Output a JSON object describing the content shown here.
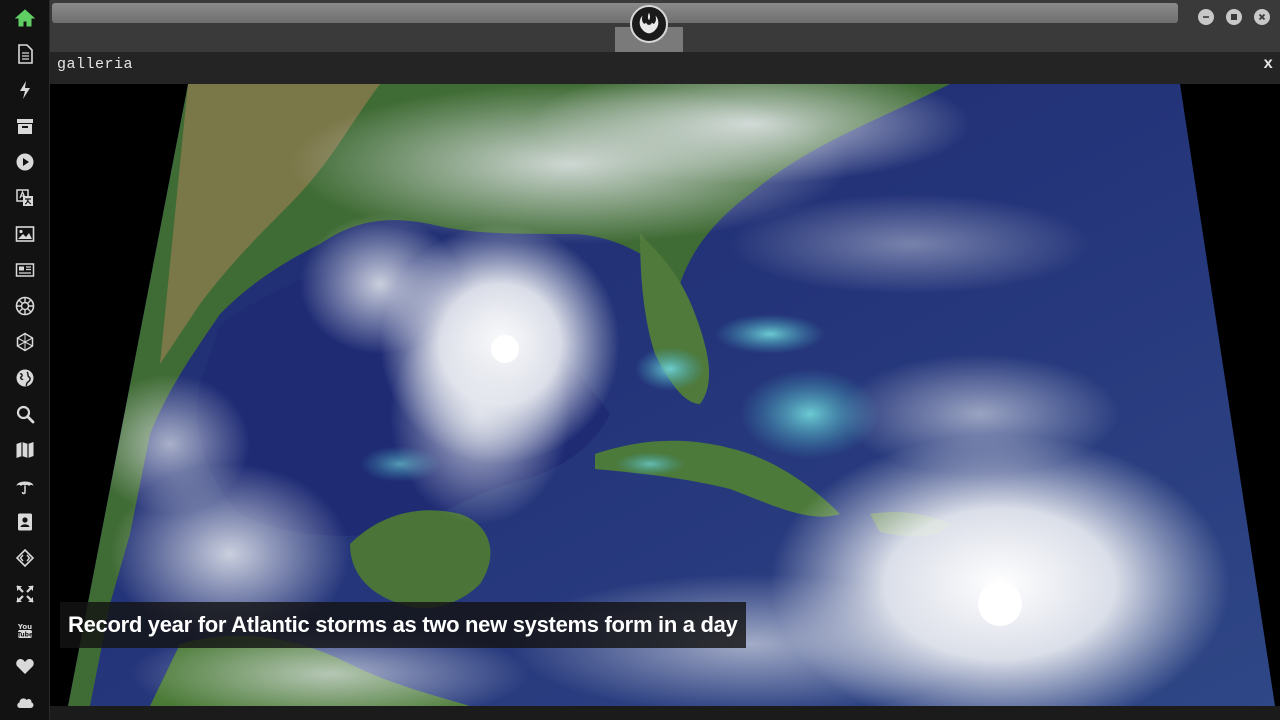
{
  "window": {
    "title": "galleria",
    "close_label": "x"
  },
  "caption": {
    "text": "Record year for Atlantic storms as two new systems form in a day"
  },
  "image": {
    "alt": "Satellite view of two tropical storm systems over the Gulf of Mexico and Caribbean"
  },
  "sidebar": {
    "items": [
      {
        "icon": "home-icon",
        "active": true
      },
      {
        "icon": "document-icon"
      },
      {
        "icon": "lightning-icon"
      },
      {
        "icon": "archive-icon"
      },
      {
        "icon": "play-icon"
      },
      {
        "icon": "translate-icon"
      },
      {
        "icon": "image-icon"
      },
      {
        "icon": "newspaper-icon"
      },
      {
        "icon": "galactic-empire-icon"
      },
      {
        "icon": "hexagon-network-icon"
      },
      {
        "icon": "globe-icon"
      },
      {
        "icon": "search-icon"
      },
      {
        "icon": "map-icon"
      },
      {
        "icon": "umbrella-icon"
      },
      {
        "icon": "contact-card-icon"
      },
      {
        "icon": "code-diamond-icon"
      },
      {
        "icon": "expand-icon"
      },
      {
        "icon": "youtube-icon"
      },
      {
        "icon": "heart-icon"
      },
      {
        "icon": "cloud-icon"
      }
    ]
  },
  "titlebar": {
    "buttons": [
      "minimize-icon",
      "maximize-icon",
      "close-icon"
    ]
  },
  "colors": {
    "active_icon": "#5fcf63",
    "icon": "#d9d9d9",
    "background": "#1e1e1e"
  }
}
